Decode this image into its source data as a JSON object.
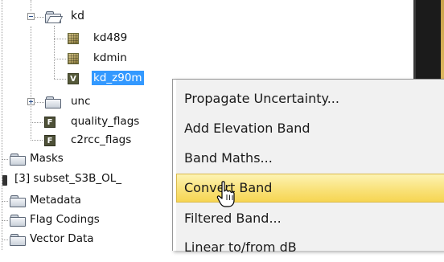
{
  "tree": {
    "kd_folder": "kd",
    "band_kd489": "kd489",
    "band_kdmin": "kdmin",
    "band_kd_z90": "kd_z90m",
    "unc_folder": "unc",
    "quality_flags": "quality_flags",
    "c2rcc_flags": "c2rcc_flags",
    "masks": "Masks",
    "product": "[3] subset_S3B_OL_",
    "metadata": "Metadata",
    "flag_codings": "Flag Codings",
    "vector_data": "Vector Data"
  },
  "menu": {
    "items": [
      "Propagate Uncertainty...",
      "Add Elevation Band",
      "Band Maths...",
      "Convert Band",
      "Filtered Band...",
      "Linear to/from dB"
    ],
    "highlighted_index": 3,
    "highlight_color": "#f9e27a",
    "selection_color": "#3399ff"
  }
}
